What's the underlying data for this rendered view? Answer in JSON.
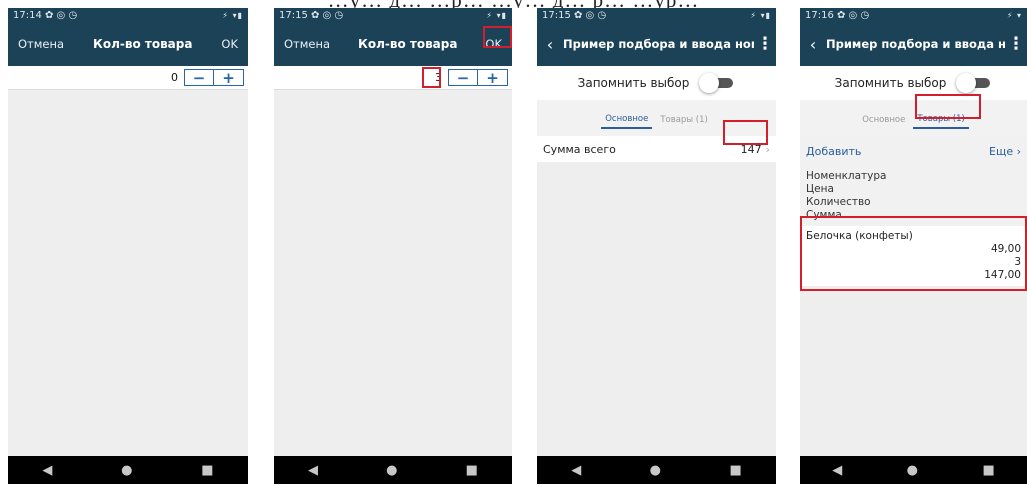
{
  "caption": "…у… д… …р… …у… д… р… …ур…",
  "phones": [
    {
      "status_time": "17:14 ✿ ◎ ◷",
      "status_icons": "⚡ ▾▮",
      "cancel_label": "Отмена",
      "title": "Кол-во товара",
      "ok_label": "OK",
      "qty_value": "0",
      "minus": "−",
      "plus": "+"
    },
    {
      "status_time": "17:15 ✿ ◎ ◷",
      "status_icons": "⚡ ▾▮",
      "cancel_label": "Отмена",
      "title": "Кол-во товара",
      "ok_label": "OK",
      "qty_value": "3",
      "minus": "−",
      "plus": "+"
    },
    {
      "status_time": "17:15 ✿ ◎ ◷",
      "status_icons": "⚡ ▾▮",
      "back": "‹",
      "title": "Пример подбора и ввода номе...",
      "menu": "⋮",
      "remember_label": "Запомнить выбор",
      "tab_main": "Основное",
      "tab_goods": "Товары (1)",
      "sum_label": "Сумма всего",
      "sum_value": "147",
      "chevron": "›"
    },
    {
      "status_time": "17:16 ✿ ◎ ◷",
      "status_icons": "⚡ ▾",
      "back": "‹",
      "title": "Пример подбора и ввода номе...",
      "menu": "⋮",
      "remember_label": "Запомнить выбор",
      "tab_main": "Основное",
      "tab_goods": "Товары (1)",
      "add_label": "Добавить",
      "more_label": "Еще ›",
      "col_nomenclature": "Номенклатура",
      "col_price": "Цена",
      "col_qty": "Количество",
      "col_sum": "Сумма",
      "item_name": "Белочка (конфеты)",
      "item_price": "49,00",
      "item_qty": "3",
      "item_sum": "147,00"
    }
  ],
  "nav": {
    "back": "◀",
    "home": "●",
    "recent": "■"
  },
  "highlight_color": "#d21f2b"
}
